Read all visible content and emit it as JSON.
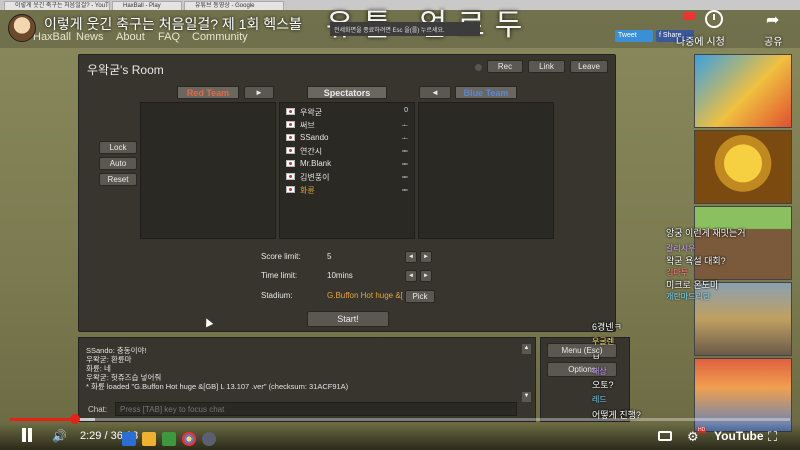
{
  "browser": {
    "tabs": [
      "이렇게 웃긴 축구는 처음일걸? - YouTube",
      "HaxBall - Play",
      "유튜브 동영상 - Google"
    ]
  },
  "video": {
    "title": "이렇게 웃긴 축구는 처음일걸? 제 1회 헥스볼",
    "overlay_big": "유튭 업로두",
    "info_box": "전세화면을 종료하려면 Esc 을(를) 누르세요.",
    "watch_later": "나중에 시청",
    "share": "공유",
    "time": "2:29 / 36:18",
    "logo": "YouTube",
    "hd": "HD",
    "tweet": "Tweet",
    "fb": "f Share"
  },
  "site_nav": {
    "brand": "HaxBall",
    "links": [
      "News",
      "About",
      "FAQ",
      "Community"
    ]
  },
  "room": {
    "title": "우왁굳's Room",
    "buttons": {
      "rec": "Rec",
      "link": "Link",
      "leave": "Leave"
    },
    "red_team_label": "Red Team",
    "blue_team_label": "Blue Team",
    "spectators_label": "Spectators",
    "move_red": "►",
    "move_blue": "◄",
    "side": {
      "lock": "Lock",
      "auto": "Auto",
      "reset": "Reset"
    },
    "spectators": [
      {
        "name": "우왁굳",
        "badge": "0",
        "color": "#e4e4e4"
      },
      {
        "name": "써브",
        "badge": "ᆠ",
        "color": "#e4e4e4"
      },
      {
        "name": "SSando",
        "badge": "ᆠ",
        "color": "#e4e4e4"
      },
      {
        "name": "연간시",
        "badge": "ᆍ",
        "color": "#e4e4e4"
      },
      {
        "name": "Mr.Blank",
        "badge": "ᆍ",
        "color": "#e4e4e4"
      },
      {
        "name": "김변풍이",
        "badge": "ᆍ",
        "color": "#e4e4e4"
      },
      {
        "name": "화륜",
        "badge": "ᆍ",
        "color": "#e3a33e"
      }
    ],
    "settings": {
      "score_label": "Score limit:",
      "score_value": "5",
      "time_label": "Time limit:",
      "time_value": "10mins",
      "stadium_label": "Stadium:",
      "stadium_value": "G.Buffon Hot huge &[",
      "pick": "Pick",
      "arrow_left": "◄",
      "arrow_right": "►"
    },
    "start": "Start!"
  },
  "chat": {
    "lines": [
      "SSando: 충동이야!",
      "우왁굳: 환륜마",
      "화륜: 네",
      "우왁굳: 헛쥬즈습 넣어줘",
      "* 화륜 loaded \"G.Buffon Hot huge &[GB] L 13.107 .ver\" (checksum: 31ACF91A)"
    ],
    "label": "Chat:",
    "placeholder": "Press [TAB] key to focus chat"
  },
  "menu": {
    "menu": "Menu (Esc)",
    "options": "Options"
  },
  "overlay_chat": [
    {
      "text": "앙궁 이런게 재밋는거",
      "cls": "ovl"
    },
    {
      "text": "갈리시우",
      "cls": "ovlname2"
    },
    {
      "text": "왁굳 욕설 대회?",
      "cls": "ovl"
    },
    {
      "text": "김마투",
      "cls": "ovlname3"
    },
    {
      "text": "미크로 온도미",
      "cls": "ovl"
    },
    {
      "text": "개란마드리딘",
      "cls": "ovlname4"
    },
    {
      "text": "6경넨ㅋ",
      "cls": "ovl"
    },
    {
      "text": "우굴렌",
      "cls": "ovlyel"
    },
    {
      "text": "ㅂ",
      "cls": "ovl"
    },
    {
      "text": "해상",
      "cls": "ovlname2"
    },
    {
      "text": "오토?",
      "cls": "ovl"
    },
    {
      "text": "레드",
      "cls": "ovlname4"
    },
    {
      "text": "어떻게 진행?",
      "cls": "ovl"
    }
  ],
  "colors": {
    "red_team": "#e06a4a",
    "blue_team": "#5a86d6",
    "progress_played": "#e62117",
    "stadium": "#e3a33e"
  },
  "thumb_games": [
    "subway-surfers-icon",
    "temple-run-icon",
    "minecraft-icon",
    "gta-icon",
    "subway-runner-icon"
  ]
}
